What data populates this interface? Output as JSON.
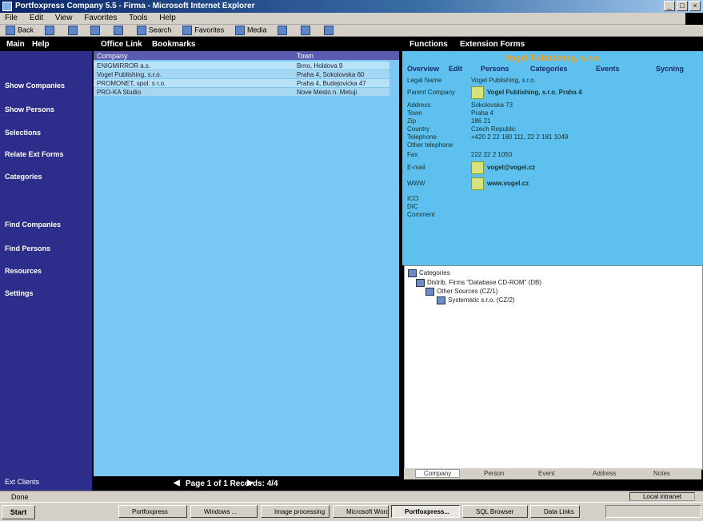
{
  "window": {
    "title": "Portfoxpress Company 5.5 - Firma - Microsoft Internet Explorer"
  },
  "menu": [
    "File",
    "Edit",
    "View",
    "Favorites",
    "Tools",
    "Help"
  ],
  "toolbar": {
    "back": "Back",
    "search": "Search",
    "favorites": "Favorites",
    "media": "Media"
  },
  "app": {
    "left_menu": [
      "Main",
      "Help"
    ],
    "center_menu": [
      "Office Link",
      "Bookmarks"
    ],
    "right_menu": [
      "Functions",
      "Extension Forms"
    ]
  },
  "sidebar": {
    "items": [
      "Show Companies",
      "Show Persons",
      "Selections",
      "Relate Ext Forms",
      "Categories",
      "Find Companies",
      "Find Persons",
      "Resources",
      "Settings"
    ],
    "footer": "Ext Clients"
  },
  "grid": {
    "columns": [
      "Company",
      "Town"
    ],
    "rows": [
      [
        "ENIGMIRROR a.s.",
        "Brno, Holdova 9"
      ],
      [
        "Vogel Publishing, s.r.o.",
        "Praha 4, Sokolovska 60"
      ],
      [
        "PROMONET, spol. s r.o.",
        "Praha 4, Budejovicka 47"
      ],
      [
        "PRO-KA Studio",
        "Nove Mesto n. Metuji"
      ]
    ]
  },
  "pager": {
    "text": "Page 1 of 1   Records: 4/4"
  },
  "detail": {
    "title": "Vogel Publishing, s.r.o.",
    "tabs": [
      "Overview",
      "Edit",
      "Persons",
      "Categories",
      "Events",
      "Sycning"
    ],
    "fields": [
      {
        "label": "Legal Name",
        "value": "Vogel Publishing, s.r.o."
      },
      {
        "label": "Parent Company",
        "value": "Vogel Publishing, s.r.o. Praha 4",
        "icon": true,
        "bold": true
      },
      {
        "label": "Address",
        "value": "Sokolovska 73"
      },
      {
        "label": "Town",
        "value": "Praha 4"
      },
      {
        "label": "Zip",
        "value": "186 21"
      },
      {
        "label": "Country",
        "value": "Czech Republic"
      },
      {
        "label": "Telephone",
        "value": "+420 2 22 180 111, 22 2 181 1049"
      },
      {
        "label": "Other telephone",
        "value": ""
      },
      {
        "label": "Fax",
        "value": "222 22 2 1050"
      },
      {
        "label": "E-mail",
        "value": "vogel@vogel.cz",
        "icon": true,
        "bold": true
      },
      {
        "label": "WWW",
        "value": "www.vogel.cz",
        "icon": true,
        "bold": true
      },
      {
        "label": "ICO",
        "value": ""
      },
      {
        "label": "DIC",
        "value": ""
      },
      {
        "label": "Comment",
        "value": ""
      }
    ]
  },
  "tree": {
    "nodes": [
      {
        "label": "Categories",
        "level": 0
      },
      {
        "label": "Distrib. Firms \"Database CD-ROM\" (DB)",
        "level": 1
      },
      {
        "label": "Other Sources (CZ/1)",
        "level": 2
      },
      {
        "label": "Systematic s.r.o. (CZ/2)",
        "level": 3
      }
    ],
    "tabs": [
      "Company",
      "Person",
      "Event",
      "Address",
      "Notes"
    ]
  },
  "status": {
    "text": "Done",
    "zone": "Local intranet"
  },
  "taskbar": {
    "start": "Start",
    "tasks": [
      "Portfoxpress",
      "Windows ...",
      "Image processing",
      "Microsoft Word",
      "Portfoxpress...",
      "SQL Browser",
      "Data Links"
    ]
  }
}
